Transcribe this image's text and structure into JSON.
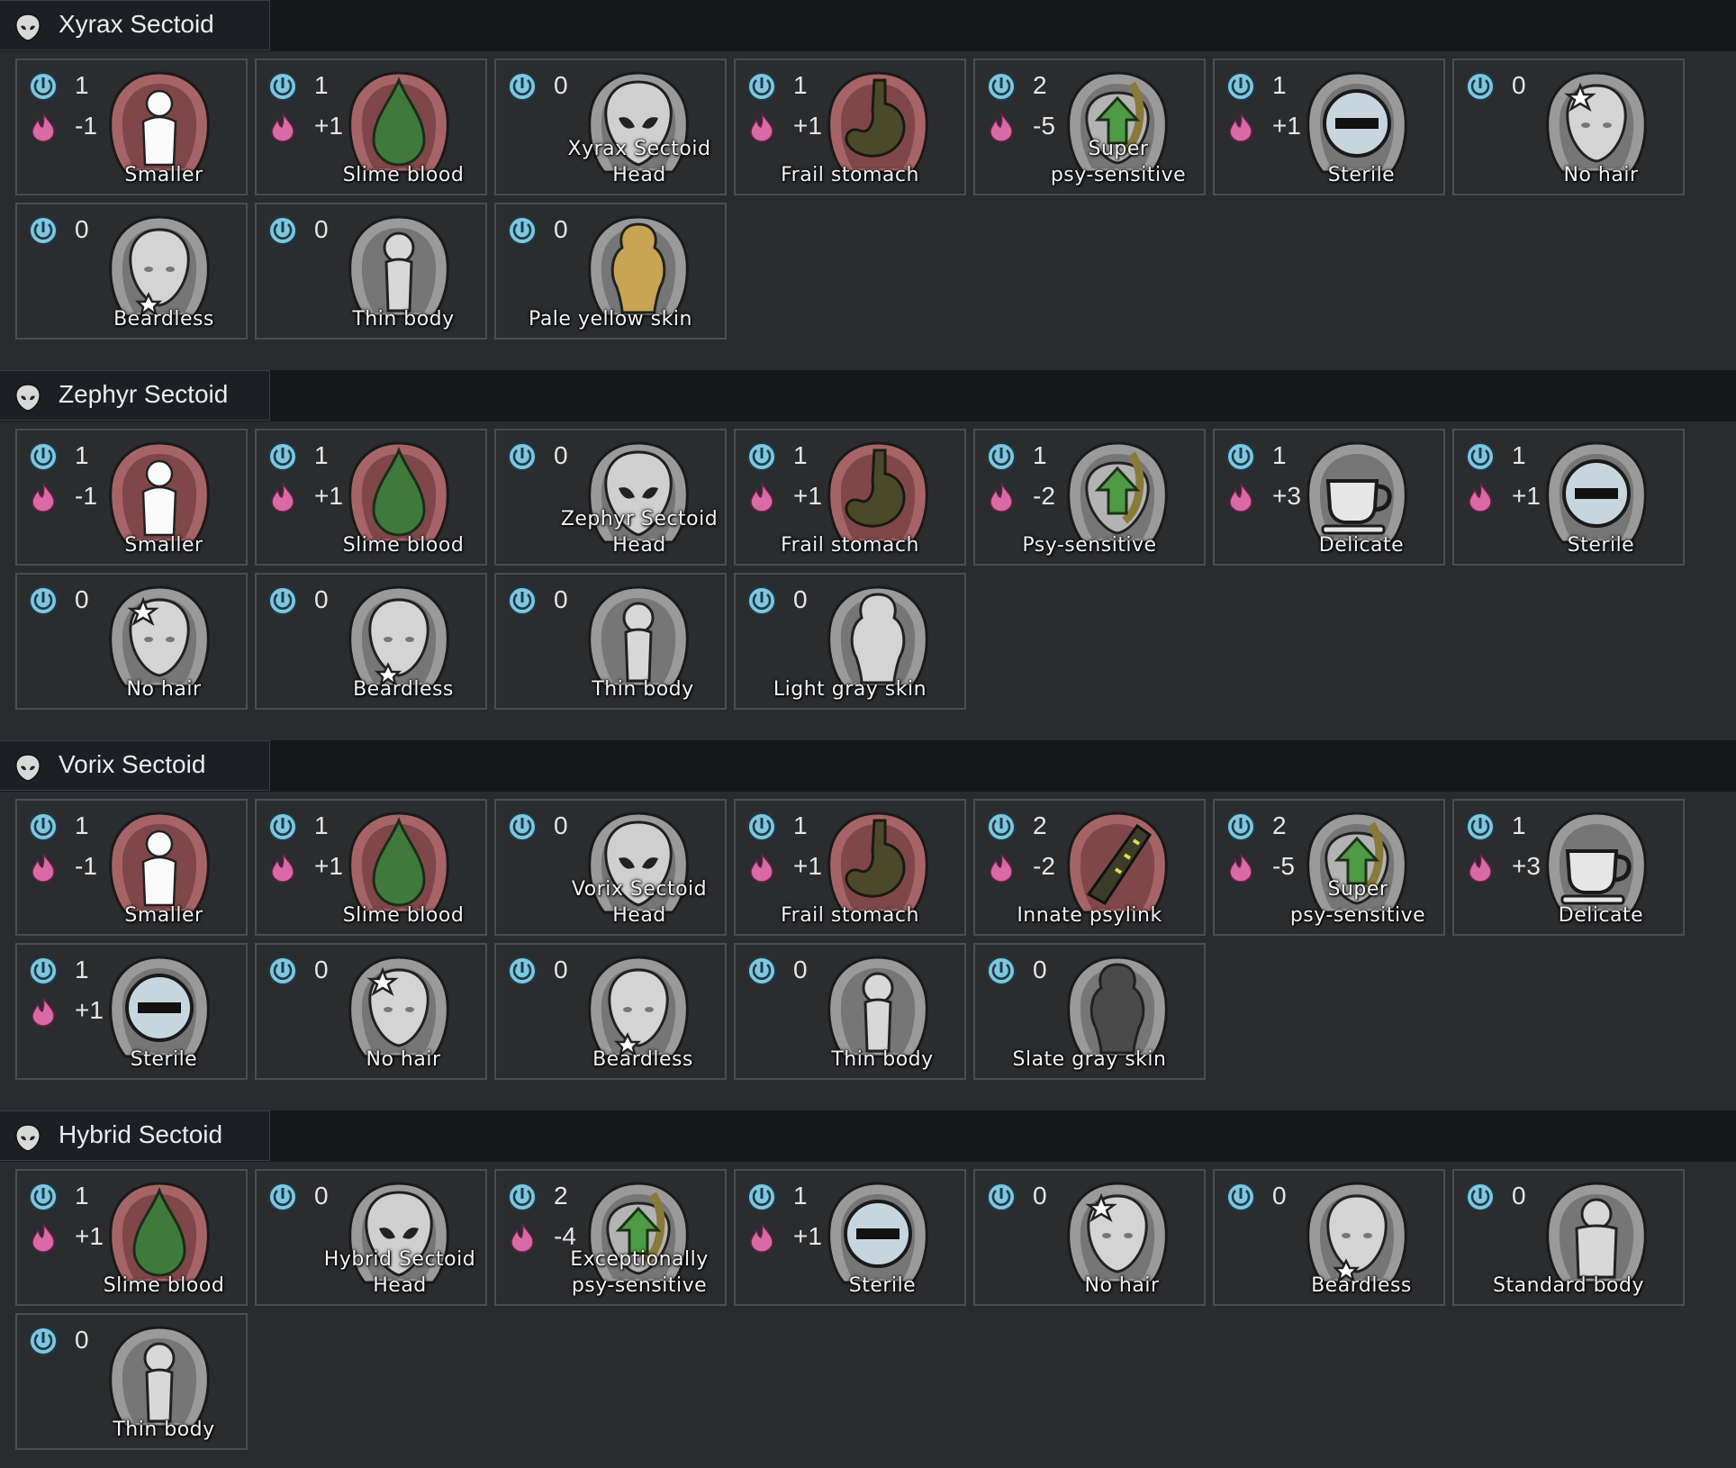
{
  "colors": {
    "header_bg": "#16181c",
    "body_bg": "#2a2b2d",
    "card_border": "#4b4d51",
    "complexity_icon": "#7fc6df",
    "metabolism_icon": "#d96aa6",
    "red_ring": "#a76467",
    "gray_ring": "#9a9a9a"
  },
  "sections": [
    {
      "title": "Xyrax Sectoid",
      "genes": [
        {
          "label": "Smaller",
          "complexity": "1",
          "metabolism": "-1",
          "icon": "smaller-icon",
          "frame": "red"
        },
        {
          "label": "Slime blood",
          "complexity": "1",
          "metabolism": "+1",
          "icon": "slime-blood-icon",
          "frame": "red"
        },
        {
          "label": "Xyrax Sectoid\nHead",
          "complexity": "0",
          "metabolism": null,
          "icon": "alien-head-icon",
          "frame": "gray"
        },
        {
          "label": "Frail stomach",
          "complexity": "1",
          "metabolism": "+1",
          "icon": "stomach-icon",
          "frame": "red"
        },
        {
          "label": "Super\npsy-sensitive",
          "complexity": "2",
          "metabolism": "-5",
          "icon": "psy-sensitive-icon",
          "frame": "gray"
        },
        {
          "label": "Sterile",
          "complexity": "1",
          "metabolism": "+1",
          "icon": "sterile-icon",
          "frame": "gray"
        },
        {
          "label": "No hair",
          "complexity": "0",
          "metabolism": null,
          "icon": "no-hair-icon",
          "frame": "gray"
        },
        {
          "label": "Beardless",
          "complexity": "0",
          "metabolism": null,
          "icon": "beardless-icon",
          "frame": "gray"
        },
        {
          "label": "Thin body",
          "complexity": "0",
          "metabolism": null,
          "icon": "thin-body-icon",
          "frame": "gray"
        },
        {
          "label": "Pale yellow skin",
          "complexity": "0",
          "metabolism": null,
          "icon": "skin-icon",
          "frame": "gray",
          "skin": "#c9a453"
        }
      ]
    },
    {
      "title": "Zephyr Sectoid",
      "genes": [
        {
          "label": "Smaller",
          "complexity": "1",
          "metabolism": "-1",
          "icon": "smaller-icon",
          "frame": "red"
        },
        {
          "label": "Slime blood",
          "complexity": "1",
          "metabolism": "+1",
          "icon": "slime-blood-icon",
          "frame": "red"
        },
        {
          "label": "Zephyr Sectoid\nHead",
          "complexity": "0",
          "metabolism": null,
          "icon": "alien-head-icon",
          "frame": "gray"
        },
        {
          "label": "Frail stomach",
          "complexity": "1",
          "metabolism": "+1",
          "icon": "stomach-icon",
          "frame": "red"
        },
        {
          "label": "Psy-sensitive",
          "complexity": "1",
          "metabolism": "-2",
          "icon": "psy-sensitive-icon",
          "frame": "gray"
        },
        {
          "label": "Delicate",
          "complexity": "1",
          "metabolism": "+3",
          "icon": "delicate-icon",
          "frame": "gray"
        },
        {
          "label": "Sterile",
          "complexity": "1",
          "metabolism": "+1",
          "icon": "sterile-icon",
          "frame": "gray"
        },
        {
          "label": "No hair",
          "complexity": "0",
          "metabolism": null,
          "icon": "no-hair-icon",
          "frame": "gray"
        },
        {
          "label": "Beardless",
          "complexity": "0",
          "metabolism": null,
          "icon": "beardless-icon",
          "frame": "gray"
        },
        {
          "label": "Thin body",
          "complexity": "0",
          "metabolism": null,
          "icon": "thin-body-icon",
          "frame": "gray"
        },
        {
          "label": "Light gray skin",
          "complexity": "0",
          "metabolism": null,
          "icon": "skin-icon",
          "frame": "gray",
          "skin": "#d4d4d4"
        }
      ]
    },
    {
      "title": "Vorix Sectoid",
      "genes": [
        {
          "label": "Smaller",
          "complexity": "1",
          "metabolism": "-1",
          "icon": "smaller-icon",
          "frame": "red"
        },
        {
          "label": "Slime blood",
          "complexity": "1",
          "metabolism": "+1",
          "icon": "slime-blood-icon",
          "frame": "red"
        },
        {
          "label": "Vorix Sectoid\nHead",
          "complexity": "0",
          "metabolism": null,
          "icon": "alien-head-icon",
          "frame": "gray"
        },
        {
          "label": "Frail stomach",
          "complexity": "1",
          "metabolism": "+1",
          "icon": "stomach-icon",
          "frame": "red"
        },
        {
          "label": "Innate psylink",
          "complexity": "2",
          "metabolism": "-2",
          "icon": "psylink-icon",
          "frame": "red"
        },
        {
          "label": "Super\npsy-sensitive",
          "complexity": "2",
          "metabolism": "-5",
          "icon": "psy-sensitive-icon",
          "frame": "gray"
        },
        {
          "label": "Delicate",
          "complexity": "1",
          "metabolism": "+3",
          "icon": "delicate-icon",
          "frame": "gray"
        },
        {
          "label": "Sterile",
          "complexity": "1",
          "metabolism": "+1",
          "icon": "sterile-icon",
          "frame": "gray"
        },
        {
          "label": "No hair",
          "complexity": "0",
          "metabolism": null,
          "icon": "no-hair-icon",
          "frame": "gray"
        },
        {
          "label": "Beardless",
          "complexity": "0",
          "metabolism": null,
          "icon": "beardless-icon",
          "frame": "gray"
        },
        {
          "label": "Thin body",
          "complexity": "0",
          "metabolism": null,
          "icon": "thin-body-icon",
          "frame": "gray"
        },
        {
          "label": "Slate gray skin",
          "complexity": "0",
          "metabolism": null,
          "icon": "skin-icon",
          "frame": "gray",
          "skin": "#4a4a4a"
        }
      ]
    },
    {
      "title": "Hybrid Sectoid",
      "genes": [
        {
          "label": "Slime blood",
          "complexity": "1",
          "metabolism": "+1",
          "icon": "slime-blood-icon",
          "frame": "red"
        },
        {
          "label": "Hybrid Sectoid\nHead",
          "complexity": "0",
          "metabolism": null,
          "icon": "alien-head-icon",
          "frame": "gray"
        },
        {
          "label": "Exceptionally\npsy-sensitive",
          "complexity": "2",
          "metabolism": "-4",
          "icon": "psy-sensitive-icon",
          "frame": "gray"
        },
        {
          "label": "Sterile",
          "complexity": "1",
          "metabolism": "+1",
          "icon": "sterile-icon",
          "frame": "gray"
        },
        {
          "label": "No hair",
          "complexity": "0",
          "metabolism": null,
          "icon": "no-hair-icon",
          "frame": "gray"
        },
        {
          "label": "Beardless",
          "complexity": "0",
          "metabolism": null,
          "icon": "beardless-icon",
          "frame": "gray"
        },
        {
          "label": "Standard body",
          "complexity": "0",
          "metabolism": null,
          "icon": "standard-body-icon",
          "frame": "gray"
        },
        {
          "label": "Thin body",
          "complexity": "0",
          "metabolism": null,
          "icon": "thin-body-icon",
          "frame": "gray"
        }
      ]
    }
  ]
}
